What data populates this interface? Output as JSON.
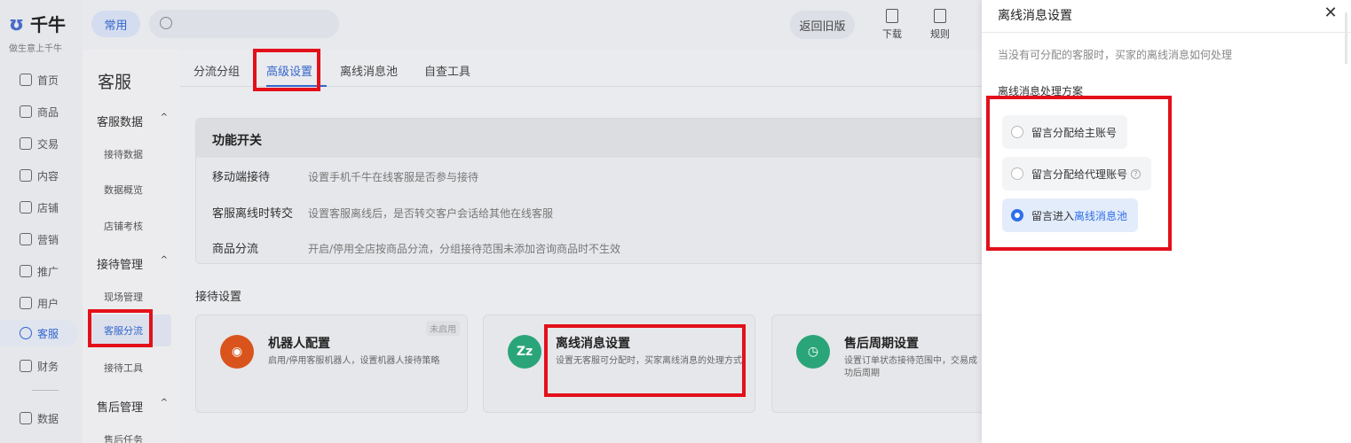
{
  "logo": {
    "brand": "千牛",
    "slogan": "做生意上千牛"
  },
  "leftnav": {
    "items": [
      {
        "label": "首页"
      },
      {
        "label": "商品"
      },
      {
        "label": "交易"
      },
      {
        "label": "内容"
      },
      {
        "label": "店铺"
      },
      {
        "label": "营销"
      },
      {
        "label": "推广"
      },
      {
        "label": "用户"
      },
      {
        "label": "客服"
      },
      {
        "label": "财务"
      },
      {
        "label": "数据"
      }
    ],
    "active": "客服"
  },
  "topbar": {
    "common": "常用",
    "old_version": "返回旧版",
    "icons": [
      {
        "label": "下载"
      },
      {
        "label": "规则"
      }
    ]
  },
  "subnav": {
    "title": "客服",
    "groups": [
      {
        "label": "客服数据",
        "items": [
          "接待数据",
          "数据概览",
          "店铺考核"
        ]
      },
      {
        "label": "接待管理",
        "items": [
          "现场管理",
          "客服分流",
          "接待工具"
        ]
      },
      {
        "label": "售后管理",
        "items": [
          "售后任务"
        ]
      }
    ],
    "active": "客服分流"
  },
  "tabs": [
    "分流分组",
    "高级设置",
    "离线消息池",
    "自查工具"
  ],
  "active_tab": "高级设置",
  "function_card": {
    "title": "功能开关",
    "rows": [
      {
        "label": "移动端接待",
        "desc": "设置手机千牛在线客服是否参与接待"
      },
      {
        "label": "客服离线时转交",
        "desc": "设置客服离线后，是否转交客户会话给其他在线客服"
      },
      {
        "label": "商品分流",
        "desc": "开启/停用全店按商品分流，分组接待范围未添加咨询商品时不生效"
      }
    ]
  },
  "reception_settings": {
    "title": "接待设置",
    "cards": [
      {
        "icon": "robot-icon",
        "color": "#d9541d",
        "title": "机器人配置",
        "desc": "启用/停用客服机器人，设置机器人接待策略",
        "badge": "未启用"
      },
      {
        "icon": "zz-icon",
        "color": "#2aa57a",
        "title": "离线消息设置",
        "desc": "设置无客服可分配时，买家离线消息的处理方式"
      },
      {
        "icon": "clock-icon",
        "color": "#2aa57a",
        "title": "售后周期设置",
        "desc": "设置订单状态接待范围中，交易成功后周期"
      }
    ]
  },
  "drawer": {
    "title": "离线消息设置",
    "hint": "当没有可分配的客服时，买家的离线消息如何处理",
    "label": "离线消息处理方案",
    "options": [
      {
        "label": "留言分配给主账号"
      },
      {
        "label": "留言分配给代理账号",
        "help": "?"
      },
      {
        "prefix": "留言进入",
        "link": "离线消息池"
      }
    ],
    "selected_index": 2
  }
}
